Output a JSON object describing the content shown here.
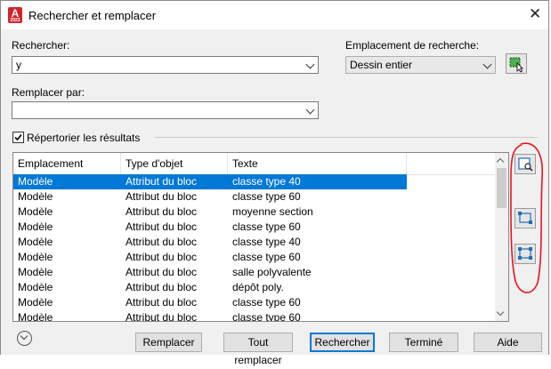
{
  "window": {
    "title": "Rechercher et remplacer",
    "app_icon_letter": "A",
    "app_icon_version": "2023",
    "close_icon": "close-icon"
  },
  "find": {
    "label": "Rechercher:",
    "value": "y"
  },
  "replace": {
    "label": "Remplacer par:",
    "value": ""
  },
  "search_location": {
    "label": "Emplacement de recherche:",
    "value": "Dessin entier",
    "select_objects_icon": "select-objects-icon"
  },
  "list_results": {
    "label": "Répertorier les résultats",
    "checked": true
  },
  "results": {
    "columns": [
      "Emplacement",
      "Type d'objet",
      "Texte"
    ],
    "rows": [
      [
        "Modèle",
        "Attribut du bloc",
        "classe type 40"
      ],
      [
        "Modèle",
        "Attribut du bloc",
        "classe type 60"
      ],
      [
        "Modèle",
        "Attribut du bloc",
        "moyenne section"
      ],
      [
        "Modèle",
        "Attribut du bloc",
        "classe type 60"
      ],
      [
        "Modèle",
        "Attribut du bloc",
        "classe type 40"
      ],
      [
        "Modèle",
        "Attribut du bloc",
        "classe type 60"
      ],
      [
        "Modèle",
        "Attribut du bloc",
        "salle polyvalente"
      ],
      [
        "Modèle",
        "Attribut du bloc",
        "dépôt poly."
      ],
      [
        "Modèle",
        "Attribut du bloc",
        "classe type 60"
      ],
      [
        "Modèle",
        "Attribut du bloc",
        "classe type 60"
      ]
    ],
    "selected_row": 0
  },
  "side_tools": [
    "zoom-to-highlighted-icon",
    "create-selection-set-highlighted-icon",
    "create-selection-set-all-icon"
  ],
  "buttons": {
    "replace": "Remplacer",
    "replace_all": "Tout remplacer",
    "find": "Rechercher",
    "done": "Terminé",
    "help": "Aide"
  },
  "colors": {
    "selection": "#0078d7",
    "annotation": "#e8141e",
    "app_icon": "#d3232a"
  }
}
